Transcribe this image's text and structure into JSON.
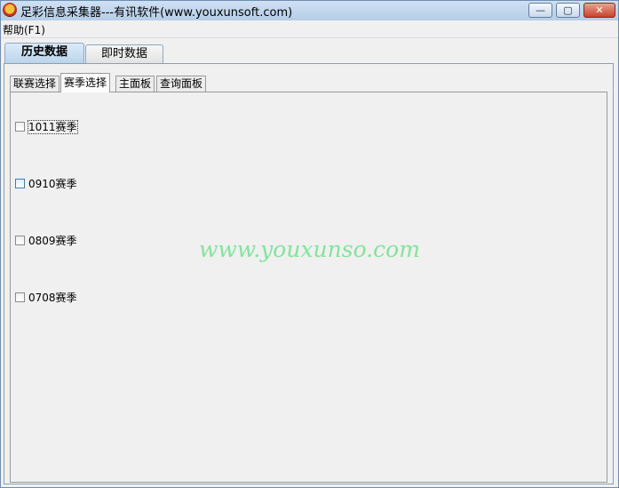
{
  "window": {
    "title": "足彩信息采集器---有讯软件(www.youxunsoft.com)",
    "icon": "app-ball-icon",
    "controls": {
      "minimize": "—",
      "maximize": "▢",
      "close": "✕"
    }
  },
  "menubar": {
    "help": "帮助(F1)"
  },
  "outer_tabs": [
    {
      "label": "历史数据",
      "selected": true
    },
    {
      "label": "即时数据",
      "selected": false
    }
  ],
  "inner_tabs": [
    {
      "label": "联赛选择",
      "selected": false
    },
    {
      "label": "赛季选择",
      "selected": true
    },
    {
      "label": "主面板",
      "selected": false
    },
    {
      "label": "查询面板",
      "selected": false
    }
  ],
  "seasons": [
    {
      "label": "1011赛季",
      "checked": false
    },
    {
      "label": "0910赛季",
      "checked": false
    },
    {
      "label": "0809赛季",
      "checked": false
    },
    {
      "label": "0708赛季",
      "checked": false
    }
  ],
  "watermark": "www.youxunso.com",
  "colors": {
    "titlebar": "#bcd3ea",
    "watermark": "#83e39b",
    "client": "#f0f0f0"
  }
}
